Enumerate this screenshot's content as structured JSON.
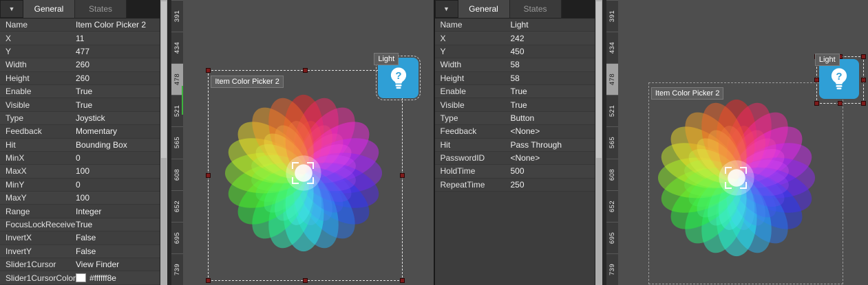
{
  "tabs": {
    "general": "General",
    "states": "States"
  },
  "icons": {
    "dropdown": "▼",
    "light_button_icon": "lightbulb-icon",
    "cursor_icon": "view-finder-icon"
  },
  "colors": {
    "light_button": "#2f9fd6",
    "selection_handle": "#7e1b1b",
    "ruler_marker_green": "#3db33d",
    "cursor_color_swatch": "#ffffff"
  },
  "left_inspector": {
    "rows": [
      {
        "label": "Name",
        "value": "Item Color Picker 2"
      },
      {
        "label": "X",
        "value": "11"
      },
      {
        "label": "Y",
        "value": "477"
      },
      {
        "label": "Width",
        "value": "260"
      },
      {
        "label": "Height",
        "value": "260"
      },
      {
        "label": "Enable",
        "value": "True"
      },
      {
        "label": "Visible",
        "value": "True"
      },
      {
        "label": "Type",
        "value": "Joystick"
      },
      {
        "label": "Feedback",
        "value": "Momentary"
      },
      {
        "label": "Hit",
        "value": "Bounding Box"
      },
      {
        "label": "MinX",
        "value": "0"
      },
      {
        "label": "MaxX",
        "value": "100"
      },
      {
        "label": "MinY",
        "value": "0"
      },
      {
        "label": "MaxY",
        "value": "100"
      },
      {
        "label": "Range",
        "value": "Integer"
      },
      {
        "label": "FocusLockReceive",
        "value": "True"
      },
      {
        "label": "InvertX",
        "value": "False"
      },
      {
        "label": "InvertY",
        "value": "False"
      },
      {
        "label": "Slider1Cursor",
        "value": "View Finder"
      },
      {
        "label": "Slider1CursorColor",
        "value": "#ffffff8e",
        "swatch": "#ffffff"
      }
    ]
  },
  "right_inspector": {
    "rows": [
      {
        "label": "Name",
        "value": "Light"
      },
      {
        "label": "X",
        "value": "242"
      },
      {
        "label": "Y",
        "value": "450"
      },
      {
        "label": "Width",
        "value": "58"
      },
      {
        "label": "Height",
        "value": "58"
      },
      {
        "label": "Enable",
        "value": "True"
      },
      {
        "label": "Visible",
        "value": "True"
      },
      {
        "label": "Type",
        "value": "Button"
      },
      {
        "label": "Feedback",
        "value": "<None>"
      },
      {
        "label": "Hit",
        "value": "Pass Through"
      },
      {
        "label": "PasswordID",
        "value": "<None>"
      },
      {
        "label": "HoldTime",
        "value": "500"
      },
      {
        "label": "RepeatTime",
        "value": "250"
      }
    ]
  },
  "rulers": {
    "ticks": [
      "391",
      "434",
      "478",
      "521",
      "565",
      "608",
      "652",
      "695",
      "739"
    ],
    "highlight_tick": "478"
  },
  "left_canvas": {
    "picker_label": "Item Color Picker 2",
    "light_label": "Light"
  },
  "right_canvas": {
    "picker_label": "Item Color Picker 2",
    "light_label": "Light"
  }
}
